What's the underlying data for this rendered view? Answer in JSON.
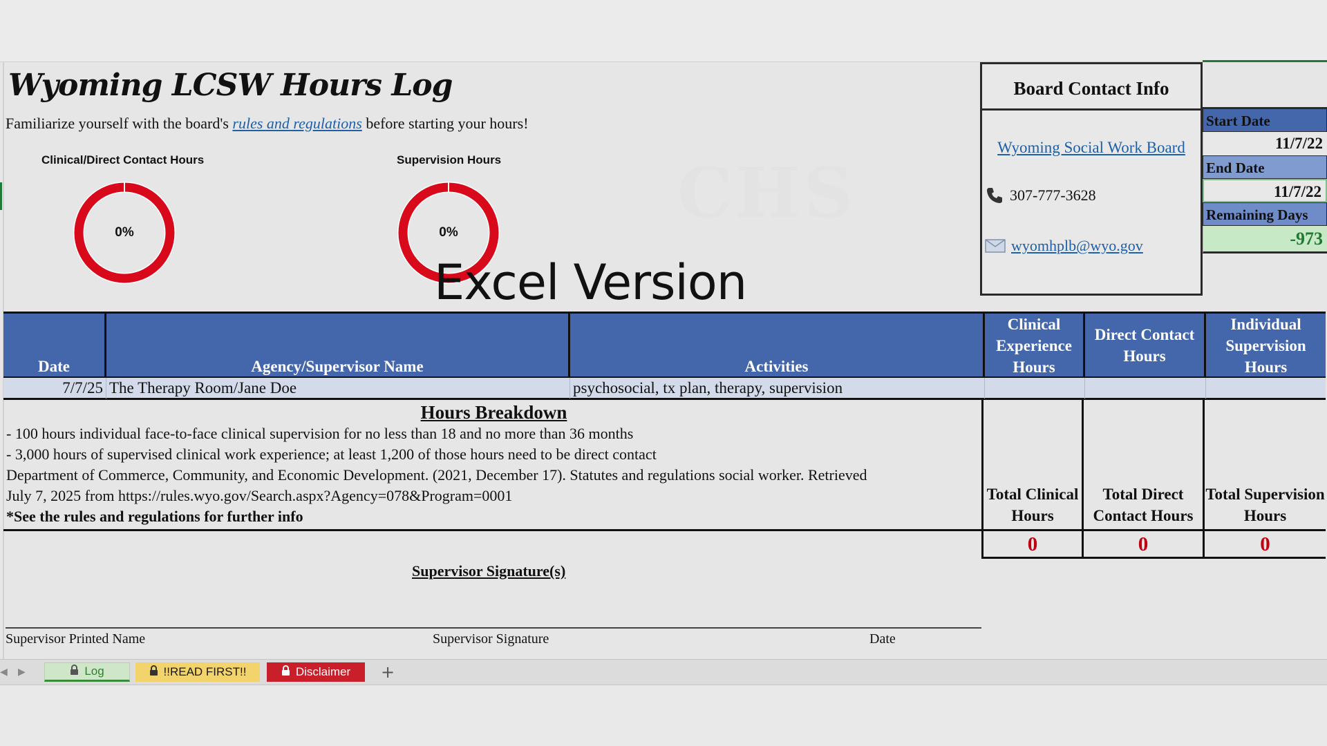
{
  "title": "Wyoming LCSW Hours Log",
  "intro": {
    "prefix": "Familiarize yourself with the board's ",
    "link": "rules and regulations",
    "suffix": " before starting your hours!"
  },
  "donuts": [
    {
      "title": "Clinical/Direct Contact Hours",
      "percent_label": "0%",
      "progress": 0,
      "ring_color": "#d8091b"
    },
    {
      "title": "Supervision Hours",
      "percent_label": "0%",
      "progress": 0,
      "ring_color": "#d8091b"
    }
  ],
  "overlay_text": "Excel Version",
  "board_contact": {
    "heading": "Board Contact Info",
    "link": "Wyoming Social Work Board",
    "phone_icon": "phone-icon",
    "phone": "307-777-3628",
    "email_icon": "mail-icon",
    "email": "wyomhplb@wyo.gov"
  },
  "dates": {
    "start_label": "Start Date",
    "start_value": "11/7/22",
    "end_label": "End Date",
    "end_value": "11/7/22",
    "remaining_label": "Remaining Days",
    "remaining_value": "-973"
  },
  "table": {
    "headers": [
      "Date",
      "Agency/Supervisor Name",
      "Activities",
      "Clinical Experience Hours",
      "Direct Contact Hours",
      "Individual Supervision Hours"
    ],
    "rows": [
      {
        "date": "7/7/25",
        "agency": "The Therapy Room/Jane Doe",
        "activities": "psychosocial, tx plan, therapy, supervision",
        "clinical": "",
        "direct": "",
        "supervision": ""
      }
    ]
  },
  "breakdown": {
    "heading": "Hours Breakdown",
    "lines": [
      "- 100 hours individual face-to-face clinical supervision for no less than 18 and no more than 36 months",
      "- 3,000 hours of supervised clinical work experience; at least 1,200 of those hours need to be direct contact",
      "Department of Commerce, Community, and Economic Development. (2021, December 17). Statutes and regulations social worker. Retrieved",
      "July 7, 2025 from https://rules.wyo.gov/Search.aspx?Agency=078&Program=0001"
    ],
    "note": "*See the rules and regulations for further info"
  },
  "totals": {
    "clinical_label": "Total Clinical Hours",
    "direct_label": "Total Direct Contact Hours",
    "supervision_label": "Total Supervision Hours",
    "clinical_value": "0",
    "direct_value": "0",
    "supervision_value": "0"
  },
  "signature": {
    "heading": "Supervisor Signature(s)",
    "printed_name": "Supervisor Printed Name",
    "signature": "Supervisor Signature",
    "date": "Date"
  },
  "tabs": [
    {
      "label": "Log",
      "icon": "lock-icon",
      "color": "#cfe7c8"
    },
    {
      "label": "!!READ FIRST!!",
      "icon": "lock-icon",
      "color": "#f3d36b"
    },
    {
      "label": "Disclaimer",
      "icon": "lock-icon",
      "color": "#c81f2b"
    }
  ],
  "add_sheet_icon": "plus-icon"
}
